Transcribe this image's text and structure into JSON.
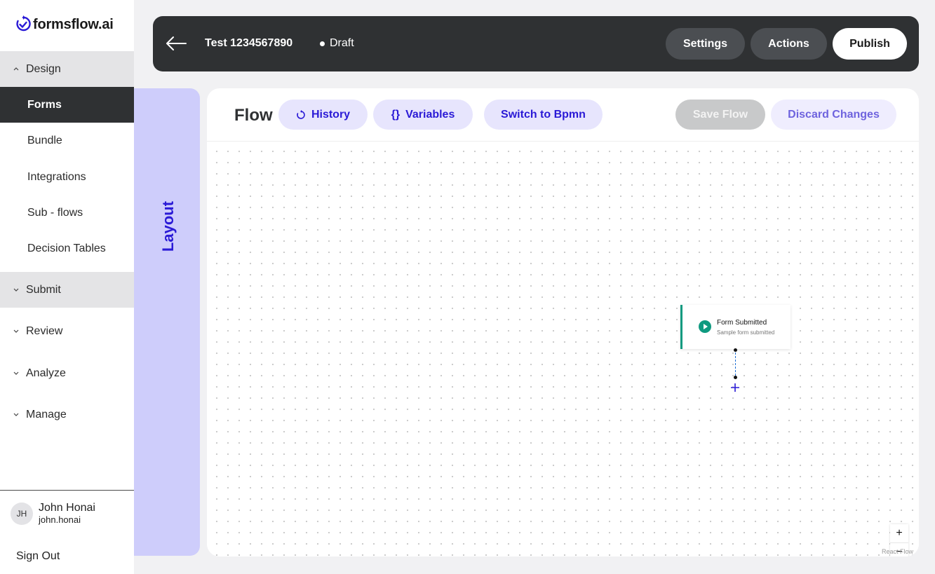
{
  "brand": {
    "name": "formsflow.ai",
    "accent": "#2a1ad6"
  },
  "sidebar": {
    "sections": [
      {
        "label": "Design",
        "expanded": true
      },
      {
        "label": "Submit",
        "expanded": false
      },
      {
        "label": "Review",
        "expanded": false
      },
      {
        "label": "Analyze",
        "expanded": false
      },
      {
        "label": "Manage",
        "expanded": false
      }
    ],
    "design_items": [
      {
        "label": "Forms",
        "active": true
      },
      {
        "label": "Bundle"
      },
      {
        "label": "Integrations"
      },
      {
        "label": "Sub - flows"
      },
      {
        "label": "Decision Tables"
      }
    ],
    "user": {
      "initials": "JH",
      "name": "John Honai",
      "username": "john.honai"
    },
    "sign_out": "Sign Out"
  },
  "header": {
    "title": "Test 1234567890",
    "status": "Draft",
    "buttons": {
      "settings": "Settings",
      "actions": "Actions",
      "publish": "Publish"
    }
  },
  "layout_tab": {
    "label": "Layout"
  },
  "flow": {
    "title": "Flow",
    "buttons": {
      "history": "History",
      "variables": "Variables",
      "variables_icon": "{}",
      "switch": "Switch to Bpmn",
      "save": "Save Flow",
      "discard": "Discard Changes"
    },
    "node": {
      "title": "Form Submitted",
      "subtitle": "Sample form submitted",
      "color": "#0f9a80"
    },
    "controls": {
      "zoom_in": "+",
      "zoom_out": "−"
    },
    "attribution": "React Flow"
  }
}
